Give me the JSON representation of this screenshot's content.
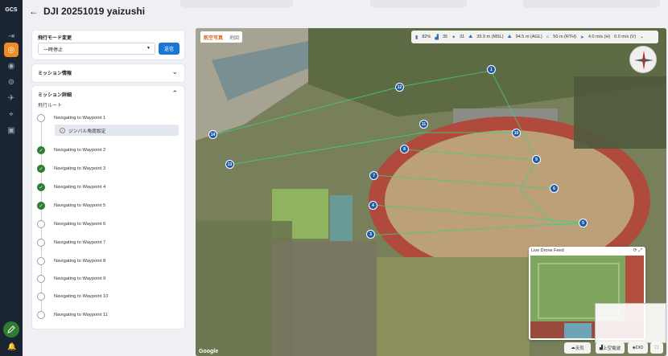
{
  "rail": {
    "logo": "GCS",
    "items": [
      {
        "icon": "expand-icon"
      },
      {
        "icon": "drone-icon"
      },
      {
        "icon": "target-icon"
      },
      {
        "icon": "radar-icon"
      },
      {
        "icon": "aircraft-icon"
      },
      {
        "icon": "map-pin-icon"
      },
      {
        "icon": "grid-icon"
      }
    ]
  },
  "header": {
    "back": "←",
    "title": "DJI 20251019 yaizushi"
  },
  "flight_mode": {
    "label": "飛行モード変更",
    "value": "一時停止",
    "send": "送信"
  },
  "mission_info": {
    "label": "ミッション情報"
  },
  "mission_detail": {
    "label": "ミッション詳細",
    "route_label": "飛行ルート",
    "gimbal": "ジンバル角度設定",
    "waypoints": [
      {
        "label": "Navigating to Waypoint 1",
        "done": false
      },
      {
        "label": "Navigating to Waypoint 2",
        "done": true
      },
      {
        "label": "Navigating to Waypoint 3",
        "done": true
      },
      {
        "label": "Navigating to Waypoint 4",
        "done": true
      },
      {
        "label": "Navigating to Waypoint 5",
        "done": true
      },
      {
        "label": "Navigating to Waypoint 6",
        "done": false
      },
      {
        "label": "Navigating to Waypoint 7",
        "done": false
      },
      {
        "label": "Navigating to Waypoint 8",
        "done": false
      },
      {
        "label": "Navigating to Waypoint 9",
        "done": false
      },
      {
        "label": "Navigating to Waypoint 10",
        "done": false
      },
      {
        "label": "Navigating to Waypoint 11",
        "done": false
      }
    ]
  },
  "map": {
    "type_on": "航空写真",
    "type_off": "地図",
    "google": "Google",
    "telemetry": {
      "battery": "82%",
      "signal": "35",
      "satellites": "31",
      "alt_msl": "39.9 m (MSL)",
      "alt_agl": "94.5 m (AGL)",
      "alt_rth": "50 m (RTH)",
      "speed_h": "4.0 m/s (H)",
      "speed_v": "0.0 m/s (V)"
    },
    "markers": [
      "1",
      "2",
      "3",
      "4",
      "5",
      "6",
      "7",
      "8",
      "9",
      "10",
      "11",
      "12",
      "13",
      "14"
    ],
    "feed_title": "Live Drone Feed",
    "bottom": [
      "天気",
      "上空電波",
      "DID"
    ]
  }
}
